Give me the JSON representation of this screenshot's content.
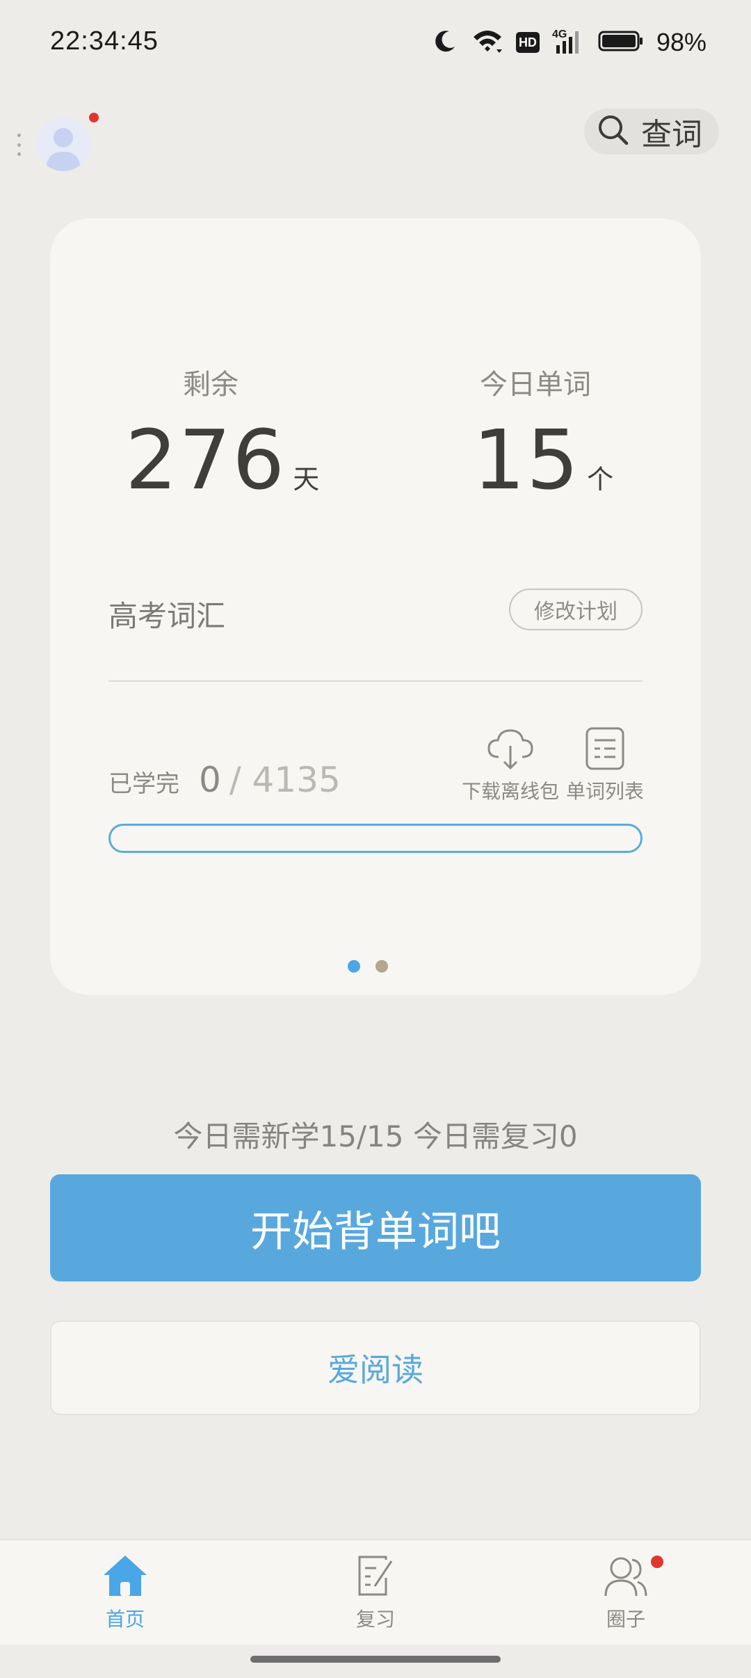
{
  "status_bar": {
    "time": "22:34:45",
    "battery": "98%",
    "network": "4G",
    "hd_label": "HD",
    "icons": [
      "moon-icon",
      "wifi-icon",
      "hd-icon",
      "signal-icon",
      "battery-icon"
    ]
  },
  "header": {
    "search_label": "查词",
    "avatar_has_notification": true
  },
  "card": {
    "remaining_label": "剩余",
    "remaining_value": "276",
    "remaining_unit": "天",
    "today_words_label": "今日单词",
    "today_words_value": "15",
    "today_words_unit": "个",
    "plan_name": "高考词汇",
    "edit_plan_label": "修改计划",
    "learned_label": "已学完",
    "learned_count": "0",
    "learned_total": "/ 4135",
    "progress_fraction": 0,
    "tools": [
      {
        "label": "下载离线包",
        "icon": "cloud-download-icon"
      },
      {
        "label": "单词列表",
        "icon": "word-list-icon"
      }
    ],
    "pager": {
      "count": 2,
      "active": 0
    }
  },
  "today_summary": "今日需新学15/15  今日需复习0",
  "start_button": "开始背单词吧",
  "read_button": "爱阅读",
  "nav": {
    "items": [
      {
        "label": "首页",
        "icon": "home-icon",
        "active": true
      },
      {
        "label": "复习",
        "icon": "review-icon",
        "active": false
      },
      {
        "label": "圈子",
        "icon": "community-icon",
        "active": false,
        "badge": true
      }
    ]
  },
  "colors": {
    "accent": "#58a8de",
    "background": "#edece8",
    "card": "#f7f6f2",
    "badge": "#e2352f",
    "inactive_dot": "#b3a78f"
  }
}
